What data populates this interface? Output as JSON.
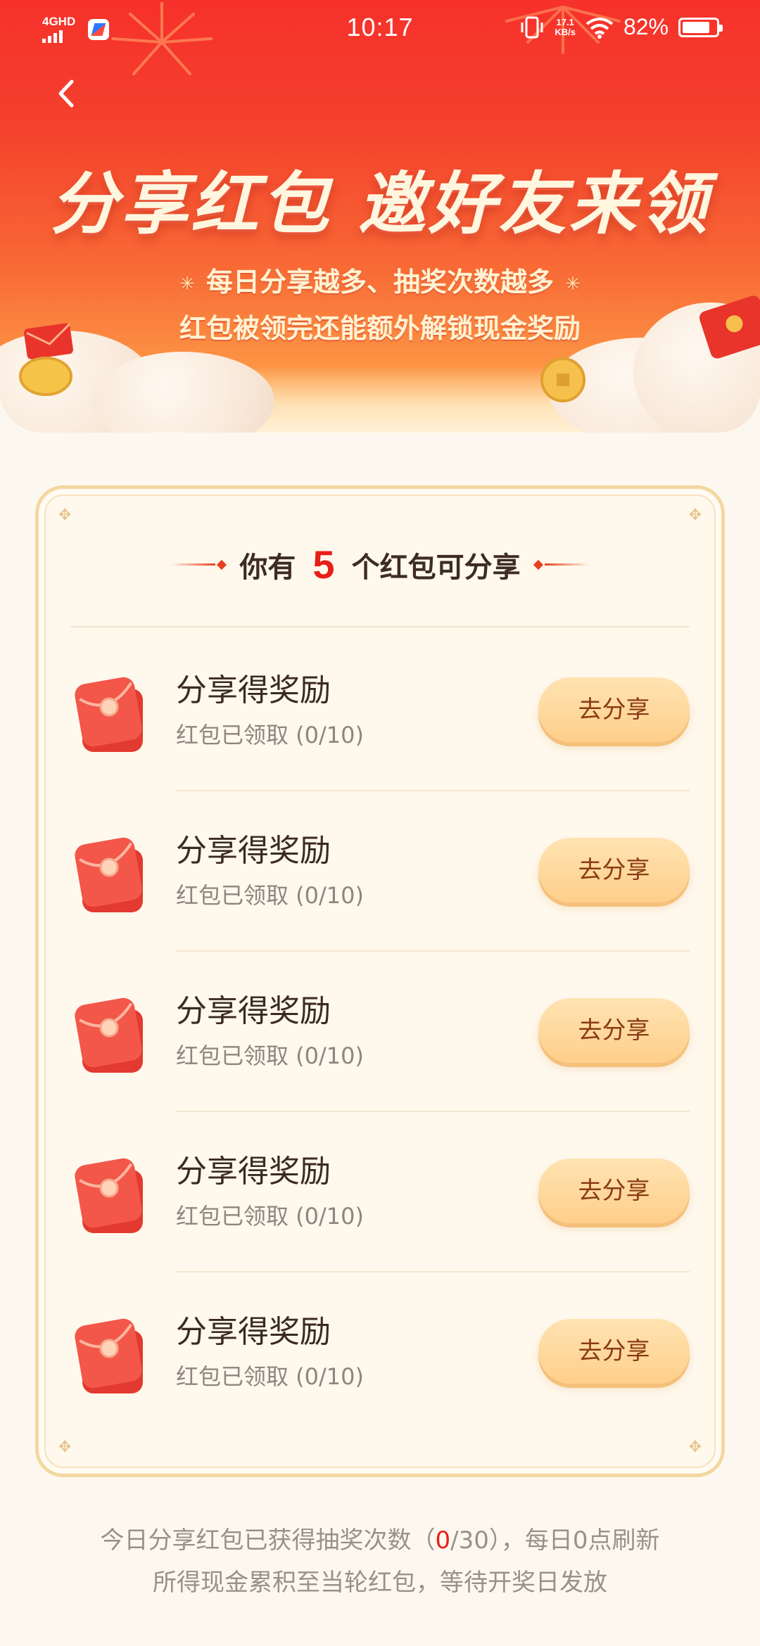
{
  "status_bar": {
    "network": "4GHD",
    "time": "10:17",
    "net_speed_value": "17.1",
    "net_speed_unit": "KB/s",
    "battery_percent": "82%",
    "battery_level": 0.82
  },
  "hero": {
    "title": "分享红包 邀好友来领",
    "subtitle_line1": "每日分享越多、抽奖次数越多",
    "subtitle_line2": "红包被领完还能额外解锁现金奖励"
  },
  "card": {
    "heading_prefix": "你有",
    "heading_count": "5",
    "heading_suffix": "个红包可分享",
    "items": [
      {
        "title": "分享得奖励",
        "status": "红包已领取 (0/10)",
        "button": "去分享"
      },
      {
        "title": "分享得奖励",
        "status": "红包已领取 (0/10)",
        "button": "去分享"
      },
      {
        "title": "分享得奖励",
        "status": "红包已领取 (0/10)",
        "button": "去分享"
      },
      {
        "title": "分享得奖励",
        "status": "红包已领取 (0/10)",
        "button": "去分享"
      },
      {
        "title": "分享得奖励",
        "status": "红包已领取 (0/10)",
        "button": "去分享"
      }
    ]
  },
  "footer": {
    "line1_prefix": "今日分享红包已获得抽奖次数（",
    "line1_count": "0",
    "line1_suffix": "/30），每日0点刷新",
    "line2": "所得现金累积至当轮红包，等待开奖日发放"
  },
  "colors": {
    "hero_red": "#f6312b",
    "accent_red": "#e71f19",
    "button_gold": "#ffcf8a",
    "card_border": "#f3d7a0"
  }
}
